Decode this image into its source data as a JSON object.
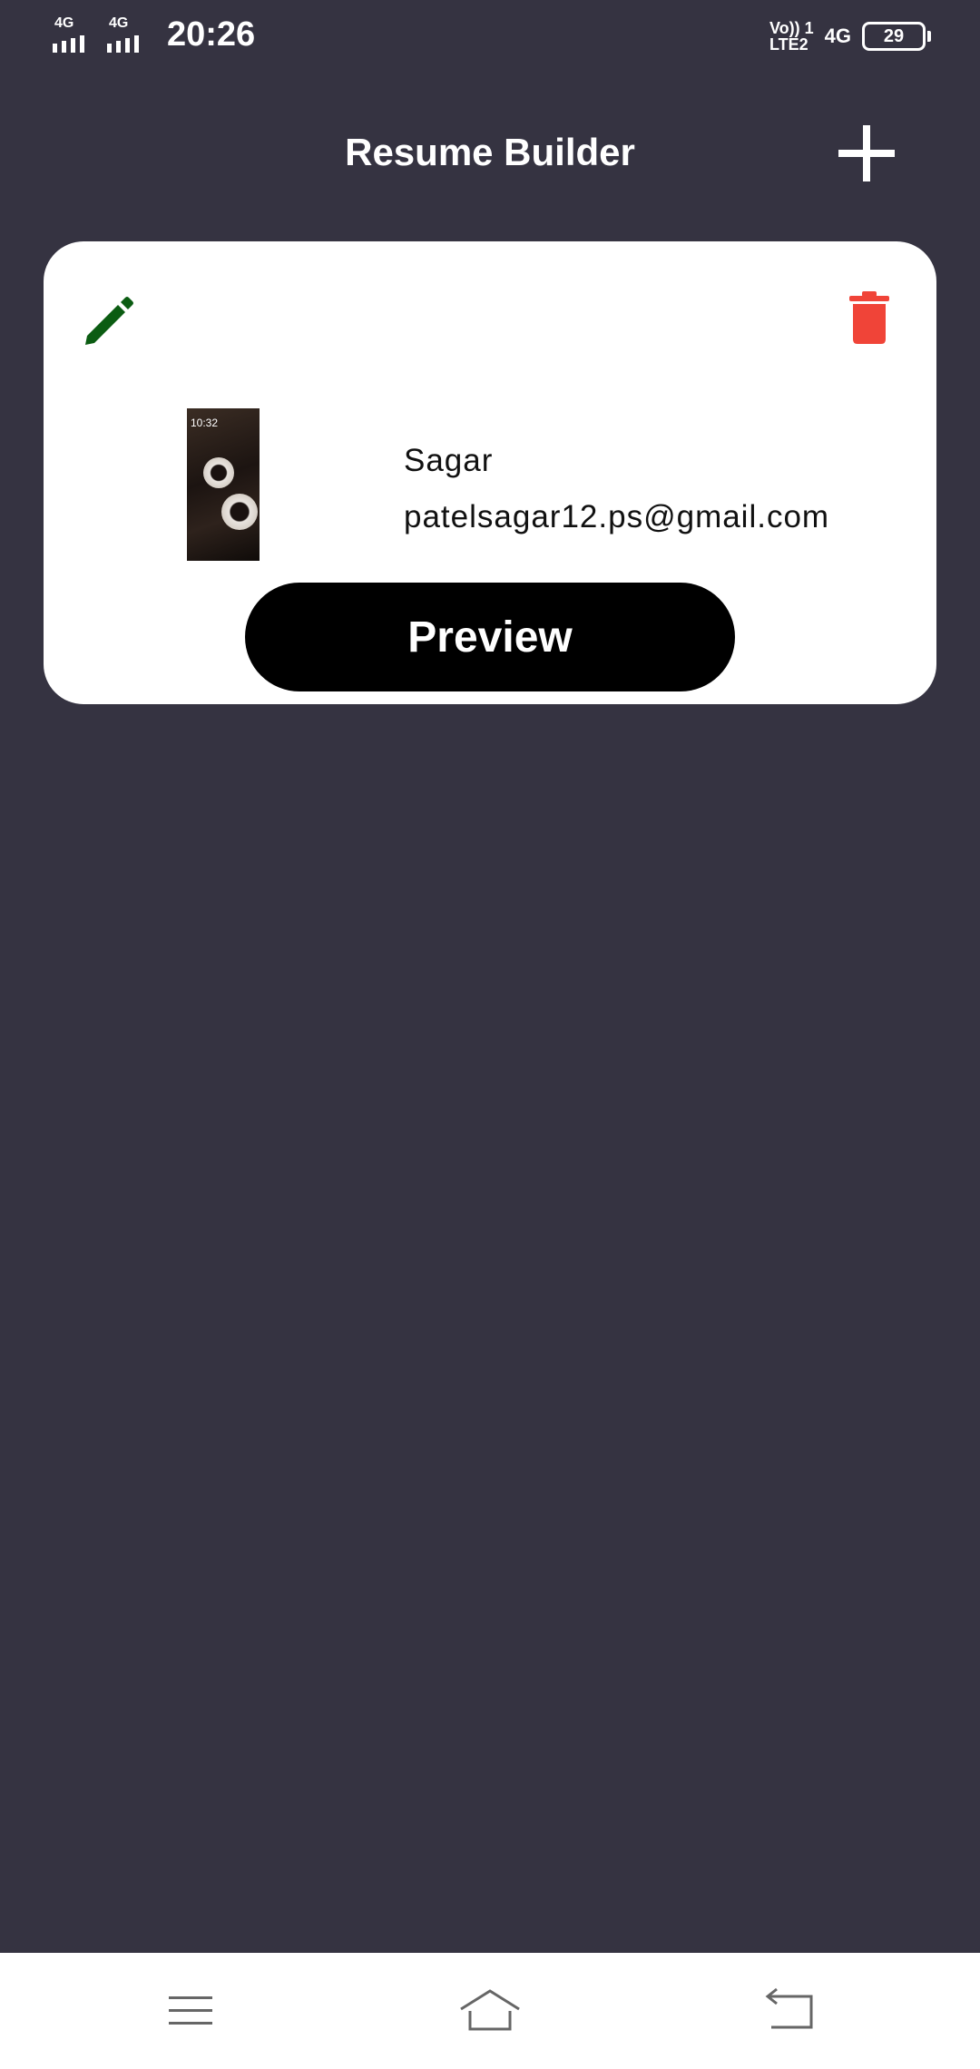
{
  "status_bar": {
    "sim1_network": "4G",
    "sim2_network": "4G",
    "time": "20:26",
    "volte_top": "Vo)) 1",
    "volte_bottom": "LTE2",
    "data_network": "4G",
    "battery_level": "29"
  },
  "app_bar": {
    "title": "Resume Builder",
    "add_icon": "plus-icon"
  },
  "resumes": [
    {
      "name": "Sagar",
      "email": "patelsagar12.ps@gmail.com",
      "thumbnail_time": "10:32",
      "preview_label": "Preview",
      "edit_icon": "pencil-icon",
      "delete_icon": "trash-icon"
    }
  ],
  "colors": {
    "background": "#353341",
    "card": "#ffffff",
    "edit_icon": "#0b5c12",
    "delete_icon": "#f04438",
    "preview_button": "#000000"
  },
  "nav_bar": {
    "icons": [
      "menu-icon",
      "home-icon",
      "back-icon"
    ]
  }
}
